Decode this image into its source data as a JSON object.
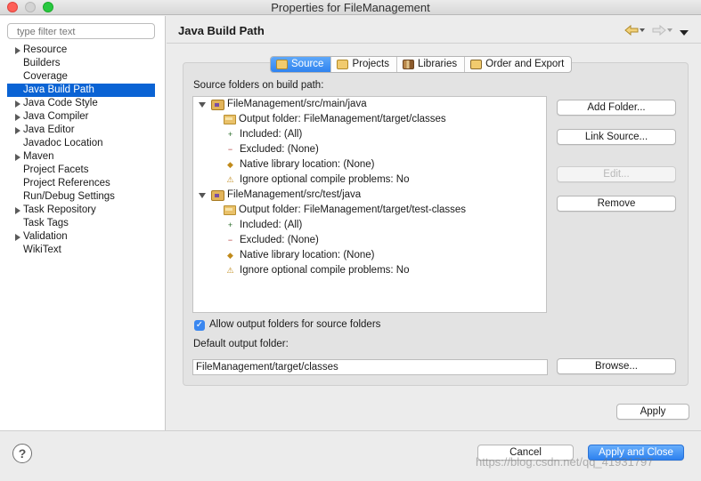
{
  "window": {
    "title": "Properties for FileManagement",
    "traffic_lights": {
      "close": "#fe5f57",
      "minimize": "#febc2e",
      "maximize": "#28c840"
    }
  },
  "sidebar": {
    "filter_placeholder": "type filter text",
    "items": [
      {
        "label": "Resource",
        "expandable": true,
        "selected": false
      },
      {
        "label": "Builders",
        "expandable": false,
        "selected": false
      },
      {
        "label": "Coverage",
        "expandable": false,
        "selected": false
      },
      {
        "label": "Java Build Path",
        "expandable": false,
        "selected": true
      },
      {
        "label": "Java Code Style",
        "expandable": true,
        "selected": false
      },
      {
        "label": "Java Compiler",
        "expandable": true,
        "selected": false
      },
      {
        "label": "Java Editor",
        "expandable": true,
        "selected": false
      },
      {
        "label": "Javadoc Location",
        "expandable": false,
        "selected": false
      },
      {
        "label": "Maven",
        "expandable": true,
        "selected": false
      },
      {
        "label": "Project Facets",
        "expandable": false,
        "selected": false
      },
      {
        "label": "Project References",
        "expandable": false,
        "selected": false
      },
      {
        "label": "Run/Debug Settings",
        "expandable": false,
        "selected": false
      },
      {
        "label": "Task Repository",
        "expandable": true,
        "selected": false
      },
      {
        "label": "Task Tags",
        "expandable": false,
        "selected": false
      },
      {
        "label": "Validation",
        "expandable": true,
        "selected": false
      },
      {
        "label": "WikiText",
        "expandable": false,
        "selected": false
      }
    ]
  },
  "header": {
    "page_title": "Java Build Path",
    "back_icon": "back-arrow-icon",
    "forward_icon": "forward-arrow-icon",
    "menu_icon": "view-menu-icon"
  },
  "tabs": [
    {
      "label": "Source",
      "icon": "source-folder-icon",
      "active": true
    },
    {
      "label": "Projects",
      "icon": "projects-icon",
      "active": false
    },
    {
      "label": "Libraries",
      "icon": "libraries-icon",
      "active": false
    },
    {
      "label": "Order and Export",
      "icon": "order-export-icon",
      "active": false
    }
  ],
  "source": {
    "tree_label": "Source folders on build path:",
    "folders": [
      {
        "name": "FileManagement/src/main/java",
        "children": [
          {
            "label": "Output folder: FileManagement/target/classes",
            "icon": "output-folder-icon"
          },
          {
            "label": "Included: (All)",
            "icon": "included-icon"
          },
          {
            "label": "Excluded: (None)",
            "icon": "excluded-icon"
          },
          {
            "label": "Native library location: (None)",
            "icon": "native-library-icon"
          },
          {
            "label": "Ignore optional compile problems: No",
            "icon": "ignore-problems-icon"
          }
        ]
      },
      {
        "name": "FileManagement/src/test/java",
        "children": [
          {
            "label": "Output folder: FileManagement/target/test-classes",
            "icon": "output-folder-icon"
          },
          {
            "label": "Included: (All)",
            "icon": "included-icon"
          },
          {
            "label": "Excluded: (None)",
            "icon": "excluded-icon"
          },
          {
            "label": "Native library location: (None)",
            "icon": "native-library-icon"
          },
          {
            "label": "Ignore optional compile problems: No",
            "icon": "ignore-problems-icon"
          }
        ]
      }
    ],
    "buttons": {
      "add_folder": "Add Folder...",
      "link_source": "Link Source...",
      "edit": "Edit...",
      "remove": "Remove"
    },
    "allow_output_label": "Allow output folders for source folders",
    "allow_output_checked": true,
    "default_output_label": "Default output folder:",
    "default_output_value": "FileManagement/target/classes",
    "browse": "Browse..."
  },
  "footer": {
    "apply": "Apply",
    "cancel": "Cancel",
    "apply_and_close": "Apply and Close",
    "watermark": "https://blog.csdn.net/qq_41931797"
  }
}
